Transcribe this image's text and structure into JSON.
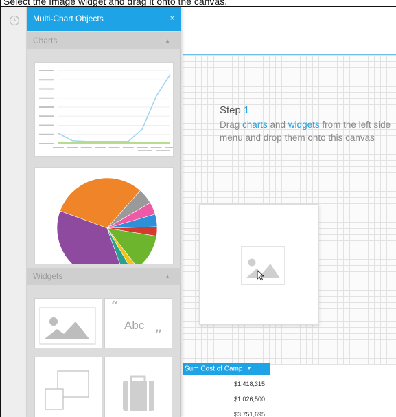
{
  "instruction": "Select the Image widget and drag it onto the canvas.",
  "icons": {
    "rail": "clock-icon",
    "close": "close-icon",
    "collapse": "chevron-up-icon",
    "image_widget": "image-icon",
    "text_widget": "text-icon",
    "container_widget": "container-icon",
    "briefcase_widget": "briefcase-icon",
    "cursor": "cursor-arrow-icon"
  },
  "colors": {
    "accent": "#1ea4e6",
    "highlight_text": "#2aa0dd",
    "panel_bg": "#dcdcdc",
    "section_bg": "#cfcfcf"
  },
  "panel": {
    "title": "Multi-Chart Objects",
    "close_label": "×",
    "charts_section": {
      "label": "Charts",
      "collapse_glyph": "▲"
    },
    "widgets_section": {
      "label": "Widgets",
      "collapse_glyph": "▲"
    },
    "text_widget": {
      "open_quote": "“",
      "label": "Abc",
      "close_quote": "”"
    }
  },
  "canvas": {
    "step_label": "Step",
    "step_number": "1",
    "text_before_charts": "Drag ",
    "charts_word": "charts",
    "text_and": " and ",
    "widgets_word": "widgets",
    "text_after": " from the left side menu and drop them onto this canvas"
  },
  "table": {
    "column_header": "Sum Cost of Camp",
    "caret": "▼",
    "rows": [
      "$1,418,315",
      "$1,026,500",
      "$3,751,695"
    ]
  },
  "chart_data": [
    {
      "type": "line",
      "x": [
        1,
        2,
        3,
        4,
        5,
        6,
        7,
        8,
        9
      ],
      "series": [
        {
          "values": [
            14,
            4,
            3,
            3,
            3,
            3,
            20,
            65,
            95
          ]
        },
        {
          "values": [
            1,
            1,
            1,
            1,
            1,
            1,
            1,
            1,
            1
          ]
        }
      ]
    },
    {
      "type": "pie",
      "slices": [
        {
          "value": 31,
          "color": "#f08428"
        },
        {
          "value": 5,
          "color": "#9a9a9a"
        },
        {
          "value": 4,
          "color": "#ef5aa6"
        },
        {
          "value": 4,
          "color": "#2f8fd8"
        },
        {
          "value": 3,
          "color": "#d43a2e"
        },
        {
          "value": 12,
          "color": "#6db52d"
        },
        {
          "value": 2,
          "color": "#f5c219"
        },
        {
          "value": 3,
          "color": "#2aa08f"
        },
        {
          "value": 36,
          "color": "#8e4a9e"
        }
      ]
    }
  ]
}
